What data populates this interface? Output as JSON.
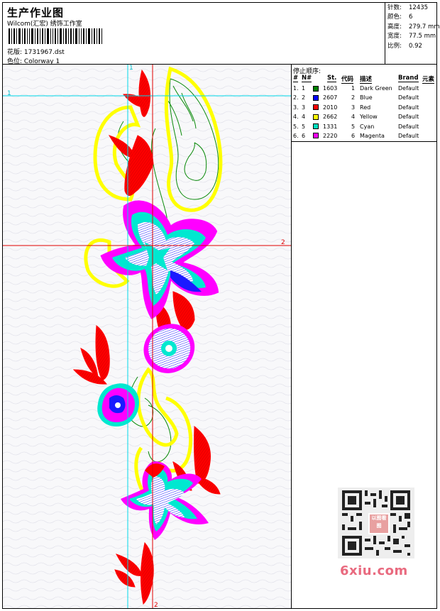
{
  "header": {
    "title": "生产作业图",
    "studio": "Wilcom(汇宏) 绣饰工作室",
    "design_label": "花版:",
    "design_value": "1731967.dst",
    "colorway_label": "色位:",
    "colorway_value": "Colorway 1"
  },
  "info": {
    "stitches_label": "针数:",
    "stitches_value": "12435",
    "colors_label": "颜色:",
    "colors_value": "6",
    "height_label": "高度:",
    "height_value": "279.7 mm",
    "width_label": "宽度:",
    "width_value": "77.5 mm",
    "scale_label": "比例:",
    "scale_value": "0.92"
  },
  "sequence": {
    "title": "停止顺序:",
    "headers": [
      "#",
      "N#",
      "St.",
      "代码",
      "描述",
      "Brand",
      "元素"
    ],
    "rows": [
      {
        "num": "1.",
        "n": "1",
        "color": "#008000",
        "st": "1603",
        "code": "1",
        "desc": "Dark Green",
        "brand": "Default"
      },
      {
        "num": "2.",
        "n": "2",
        "color": "#0000ff",
        "st": "2607",
        "code": "2",
        "desc": "Blue",
        "brand": "Default"
      },
      {
        "num": "3.",
        "n": "3",
        "color": "#ff0000",
        "st": "2010",
        "code": "3",
        "desc": "Red",
        "brand": "Default"
      },
      {
        "num": "4.",
        "n": "4",
        "color": "#ffff00",
        "st": "2662",
        "code": "4",
        "desc": "Yellow",
        "brand": "Default"
      },
      {
        "num": "5.",
        "n": "5",
        "color": "#00e0c0",
        "st": "1331",
        "code": "5",
        "desc": "Cyan",
        "brand": "Default"
      },
      {
        "num": "6.",
        "n": "6",
        "color": "#ff00ff",
        "st": "2220",
        "code": "6",
        "desc": "Magenta",
        "brand": "Default"
      }
    ]
  },
  "canvas": {
    "marker_v1": "1",
    "marker_h1": "1",
    "marker_h2": "2",
    "marker_v2": "2"
  },
  "watermark": {
    "qr_logo_text": "以图看图",
    "site": "6xiu.com"
  },
  "colors": {
    "cyan_guide": "#00d8e8",
    "red_guide": "#e00000"
  }
}
